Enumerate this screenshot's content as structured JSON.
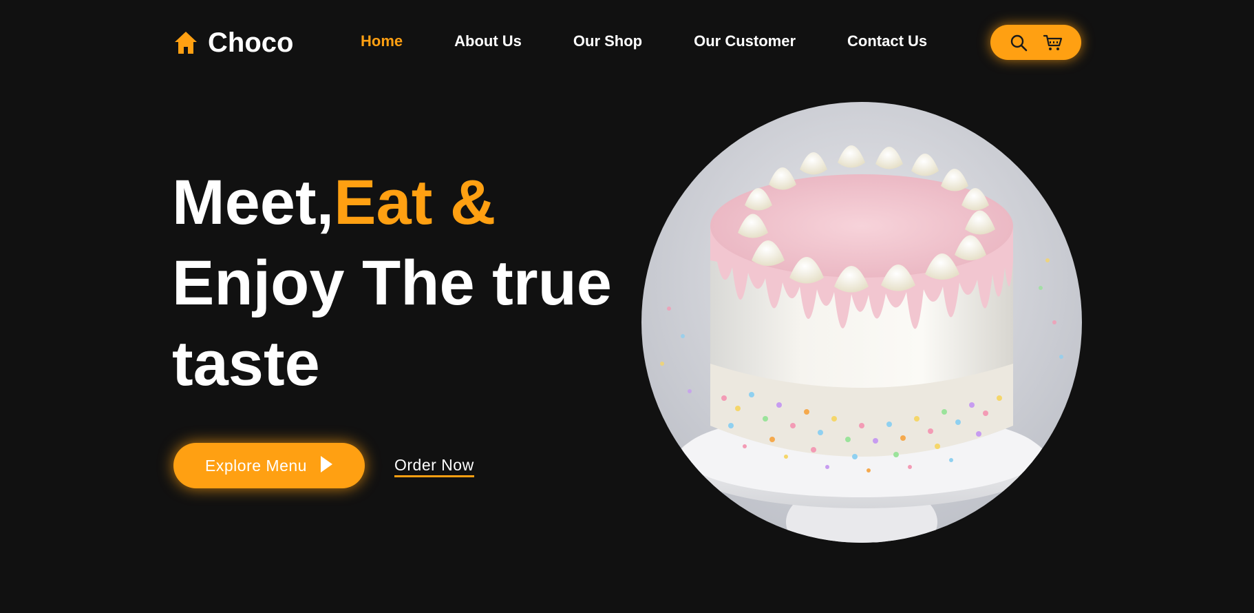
{
  "brand": {
    "name": "Choco",
    "icon": "home-icon",
    "accent_color": "#FFA012",
    "background_color": "#111111"
  },
  "nav": {
    "items": [
      {
        "label": "Home",
        "active": true
      },
      {
        "label": "About Us",
        "active": false
      },
      {
        "label": "Our Shop",
        "active": false
      },
      {
        "label": "Our Customer",
        "active": false
      },
      {
        "label": "Contact Us",
        "active": false
      }
    ],
    "actions": [
      {
        "icon": "search-icon"
      },
      {
        "icon": "cart-icon"
      }
    ]
  },
  "hero": {
    "title_part1": "Meet,",
    "title_accent": "Eat &",
    "title_line2": "Enjoy The true",
    "title_line3": "taste",
    "primary_button": "Explore Menu",
    "primary_button_icon": "play-icon",
    "secondary_link": "Order Now"
  }
}
